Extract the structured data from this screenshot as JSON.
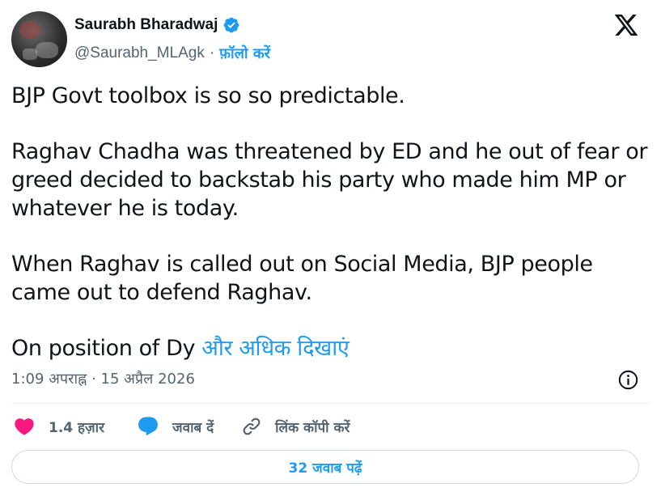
{
  "author": {
    "display_name": "Saurabh Bharadwaj",
    "handle": "@Saurabh_MLAgk",
    "separator": "·",
    "follow_label": "फ़ॉलो करें",
    "verified_color": "#1d9bf0"
  },
  "tweet": {
    "paragraphs": [
      "BJP Govt toolbox is so so predictable.",
      "Raghav Chadha was threatened by ED and he out of fear or greed decided to backstab his party who made him MP or whatever he is today.",
      "When Raghav is called out on Social Media, BJP people came out to defend Raghav."
    ],
    "truncated_text": "On position of Dy",
    "show_more_label": "और अधिक दिखाएं"
  },
  "meta": {
    "time": "1:09 अपराह्न",
    "separator": "·",
    "date": "15 अप्रैल 2026"
  },
  "actions": {
    "likes_label": "1.4 हज़ार",
    "reply_label": "जवाब दें",
    "copy_link_label": "लिंक कॉपी करें"
  },
  "read_replies_label": "32 जवाब पढ़ें",
  "colors": {
    "accent": "#1d9bf0",
    "like": "#f91880",
    "text": "#0f1419",
    "muted": "#536471",
    "border": "#cfd9de"
  },
  "icons": [
    "verified-badge-icon",
    "x-logo-icon",
    "info-icon",
    "heart-icon",
    "reply-bubble-icon",
    "link-icon"
  ]
}
